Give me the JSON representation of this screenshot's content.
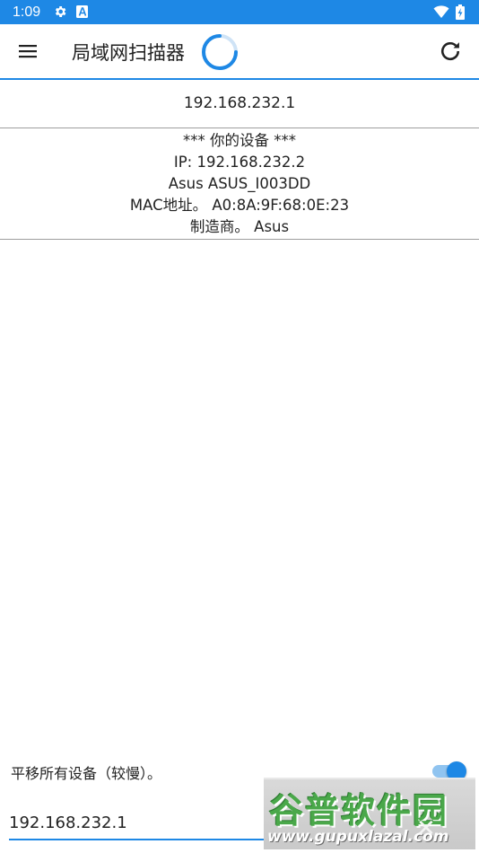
{
  "status_bar": {
    "time": "1:09",
    "icons": [
      "gear-icon",
      "a-badge-icon",
      "wifi-icon",
      "battery-charging-icon"
    ]
  },
  "app_bar": {
    "title": "局域网扫描器",
    "menu_icon": "hamburger-menu-icon",
    "refresh_icon": "refresh-icon",
    "scanning": true,
    "accent_color": "#1e88e5"
  },
  "subnet": {
    "address": "192.168.232.1"
  },
  "device": {
    "header": "*** 你的设备 ***",
    "ip": "IP: 192.168.232.2",
    "name": "Asus ASUS_I003DD",
    "mac": "MAC地址。 A0:8A:9F:68:0E:23",
    "vendor": "制造商。 Asus"
  },
  "footer": {
    "toggle_label": "平移所有设备（较慢）。",
    "toggle_on": true,
    "ip_input_value": "192.168.232.1"
  },
  "watermark": {
    "text": "谷普软件园",
    "url": "www.gupuxlazal.com"
  }
}
